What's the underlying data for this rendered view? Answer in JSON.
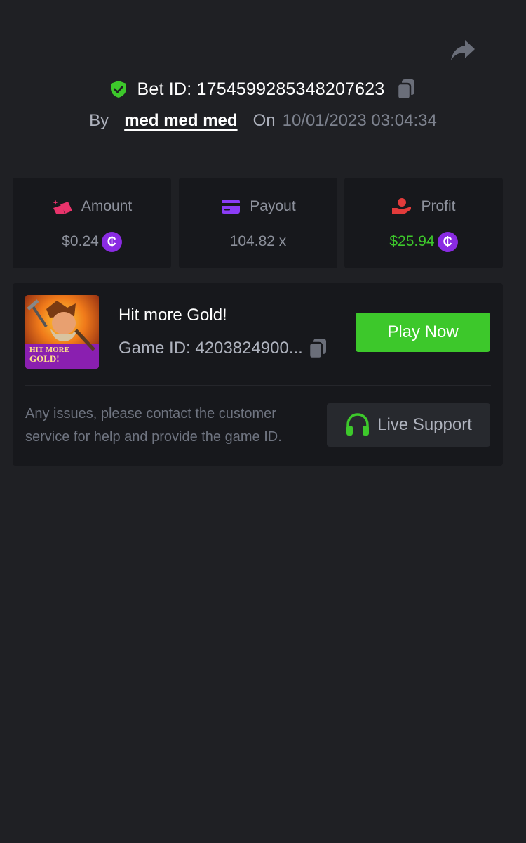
{
  "colors": {
    "background": "#1f2024",
    "card": "#17181c",
    "accent_green": "#3dc82b",
    "coin_purple": "#8a2be2",
    "amount_icon": "#e8336b",
    "payout_icon": "#8b3cf7",
    "profit_icon": "#e23b3b"
  },
  "header": {
    "bet_id": "Bet ID: 1754599285348207623",
    "by_label": "By",
    "username": "med med med",
    "on_label": "On",
    "date": "10/01/2023 03:04:34",
    "icons": [
      "share-icon",
      "shield-check-icon",
      "copy-icon"
    ]
  },
  "stats": {
    "amount": {
      "label": "Amount",
      "value": "$0.24",
      "coin": "₵",
      "icon": "gold-bars-icon"
    },
    "payout": {
      "label": "Payout",
      "value": "104.82 x",
      "icon": "credit-card-icon"
    },
    "profit": {
      "label": "Profit",
      "value": "$25.94",
      "coin": "₵",
      "icon": "hand-coin-icon"
    }
  },
  "game": {
    "thumbnail_text": "HIT MORE GOLD!",
    "title": "Hit more Gold!",
    "game_id": "Game ID: 4203824900...",
    "play_label": "Play Now",
    "help_text": "Any issues, please contact the customer service for help and provide the game ID.",
    "support_label": "Live Support",
    "support_icon": "headset-icon"
  }
}
